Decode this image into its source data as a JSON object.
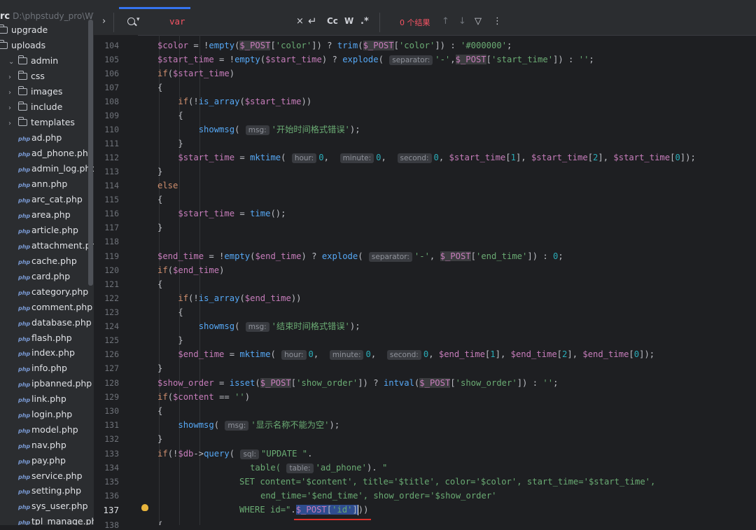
{
  "sidebar": {
    "root_label": "rc",
    "root_path": "D:\\phpstudy_pro\\WWW",
    "items": [
      {
        "label": "upgrade",
        "type": "folder"
      },
      {
        "label": "uploads",
        "type": "folder"
      },
      {
        "label": "admin",
        "type": "folder-open"
      },
      {
        "label": "css",
        "type": "folder"
      },
      {
        "label": "images",
        "type": "folder"
      },
      {
        "label": "include",
        "type": "folder"
      },
      {
        "label": "templates",
        "type": "folder"
      },
      {
        "label": "ad.php",
        "type": "php"
      },
      {
        "label": "ad_phone.php",
        "type": "php"
      },
      {
        "label": "admin_log.php",
        "type": "php"
      },
      {
        "label": "ann.php",
        "type": "php"
      },
      {
        "label": "arc_cat.php",
        "type": "php"
      },
      {
        "label": "area.php",
        "type": "php"
      },
      {
        "label": "article.php",
        "type": "php"
      },
      {
        "label": "attachment.php",
        "type": "php"
      },
      {
        "label": "cache.php",
        "type": "php"
      },
      {
        "label": "card.php",
        "type": "php"
      },
      {
        "label": "category.php",
        "type": "php"
      },
      {
        "label": "comment.php",
        "type": "php"
      },
      {
        "label": "database.php",
        "type": "php"
      },
      {
        "label": "flash.php",
        "type": "php"
      },
      {
        "label": "index.php",
        "type": "php"
      },
      {
        "label": "info.php",
        "type": "php"
      },
      {
        "label": "ipbanned.php",
        "type": "php"
      },
      {
        "label": "link.php",
        "type": "php"
      },
      {
        "label": "login.php",
        "type": "php"
      },
      {
        "label": "model.php",
        "type": "php"
      },
      {
        "label": "nav.php",
        "type": "php"
      },
      {
        "label": "pay.php",
        "type": "php"
      },
      {
        "label": "service.php",
        "type": "php"
      },
      {
        "label": "setting.php",
        "type": "php"
      },
      {
        "label": "sys_user.php",
        "type": "php"
      },
      {
        "label": "tpl_manage.php",
        "type": "php"
      }
    ],
    "php_icon_label": "php"
  },
  "find": {
    "value": "var",
    "results": "0 个结果",
    "clear_glyph": "×",
    "replace_glyph": "↵",
    "case_label": "Cc",
    "word_label": "W",
    "regex_label": ".*",
    "prev_glyph": "↑",
    "next_glyph": "↓",
    "filter_glyph": "▽",
    "more_glyph": "⋮",
    "expand_glyph": "›"
  },
  "gutter": {
    "lines": [
      "104",
      "105",
      "106",
      "107",
      "108",
      "109",
      "110",
      "111",
      "112",
      "113",
      "114",
      "115",
      "116",
      "117",
      "118",
      "119",
      "120",
      "121",
      "122",
      "123",
      "124",
      "125",
      "126",
      "127",
      "128",
      "129",
      "130",
      "131",
      "132",
      "133",
      "134",
      "135",
      "136",
      "137",
      "138"
    ],
    "current_line": "137"
  },
  "code": {
    "hints": {
      "separator": "separator:",
      "msg": "msg:",
      "hour": "hour:",
      "minute": "minute:",
      "second": "second:",
      "sql": "sql:",
      "table": "table:"
    },
    "strings": {
      "color_default": "'#000000'",
      "dash": "'-'",
      "start_err": "'开始时间格式错误'",
      "end_err": "'结束时间格式错误'",
      "name_err": "'显示名称不能为空'",
      "empty": "''",
      "update": "\"UPDATE \"",
      "ad_phone": "'ad_phone'",
      "dot_space": "\" ",
      "set_line": "SET content='$content', title='$title', color='$color', start_time='$start_time',",
      "end_line": "end_time='$end_time', show_order='$show_order'",
      "where_line": "WHERE id=\"",
      "color_key": "'color'",
      "start_key": "'start_time'",
      "end_key": "'end_time'",
      "show_key": "'show_order'",
      "id_key": "'id'"
    }
  }
}
